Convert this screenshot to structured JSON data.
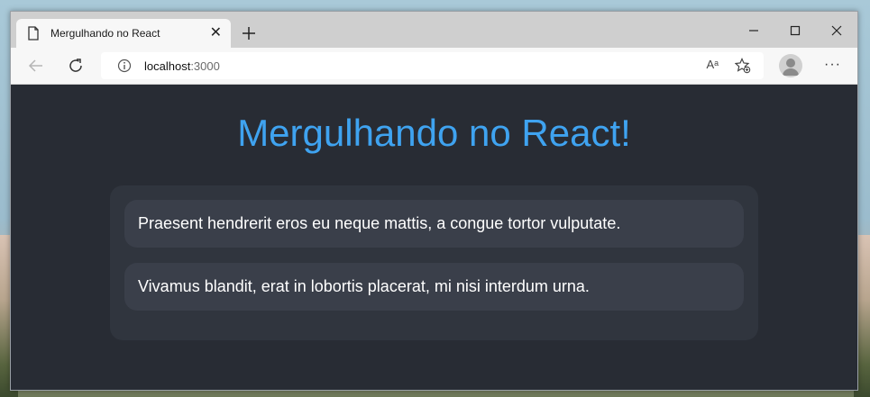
{
  "browser": {
    "tab_title": "Mergulhando no React",
    "address": {
      "host": "localhost",
      "port": ":3000"
    },
    "read_aloud_label": "Aᵃ"
  },
  "page": {
    "heading": "Mergulhando no React!",
    "items": [
      "Praesent hendrerit eros eu neque mattis, a congue tortor vulputate.",
      "Vivamus blandit, erat in lobortis placerat, mi nisi interdum urna."
    ]
  }
}
